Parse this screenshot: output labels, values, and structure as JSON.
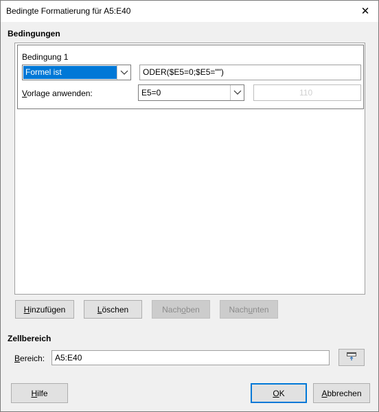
{
  "window": {
    "title": "Bedingte Formatierung für A5:E40",
    "close_label": "✕"
  },
  "conditions": {
    "section_title": "Bedingungen",
    "items": [
      {
        "title": "Bedingung 1",
        "type_value": "Formel ist",
        "formula": "ODER($E5=0;$E5=\"\")",
        "apply_style_label_pre": "V",
        "apply_style_label_post": "orlage anwenden:",
        "style_value": "E5=0",
        "preview_text": "110"
      }
    ]
  },
  "buttons": {
    "add_pre": "H",
    "add_post": "inzufügen",
    "delete_pre": "L",
    "delete_post": "öschen",
    "up_pre": "Nach ",
    "up_u": "o",
    "up_post": "ben",
    "down_pre": "Nach ",
    "down_u": "u",
    "down_post": "nten"
  },
  "cell_range": {
    "section_title": "Zellbereich",
    "label_pre": "B",
    "label_post": "ereich:",
    "value": "A5:E40"
  },
  "footer": {
    "help_pre": "H",
    "help_post": "ilfe",
    "ok_pre": "O",
    "ok_post": "K",
    "cancel_pre": "A",
    "cancel_post": "bbrechen"
  },
  "colors": {
    "accent": "#0078d7",
    "background": "#f0f0f0"
  }
}
